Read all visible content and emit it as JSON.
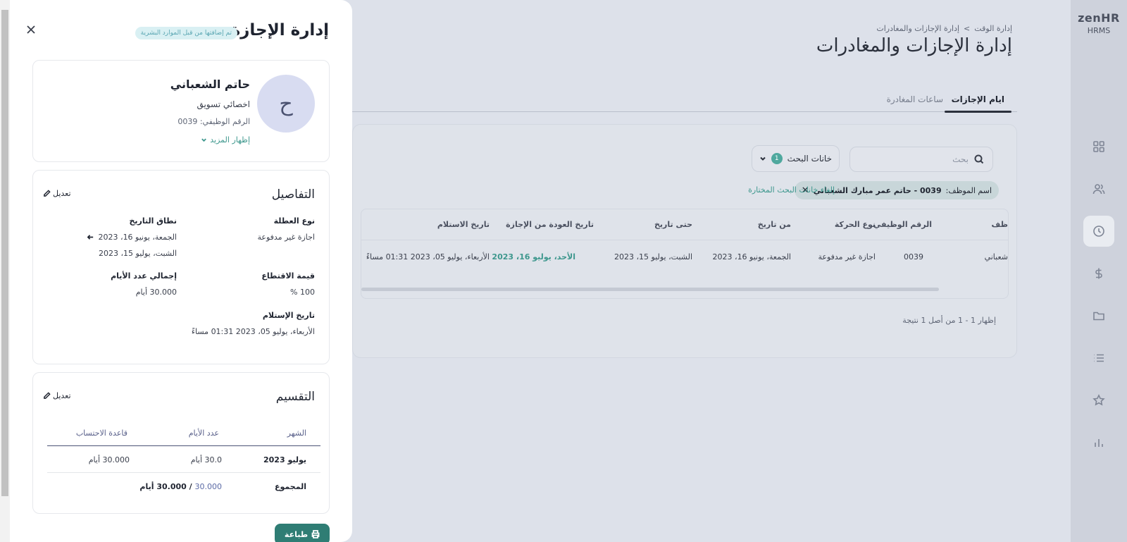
{
  "brand": {
    "name": "zenHR",
    "sub": "HRMS"
  },
  "page": {
    "breadcrumb": [
      "إدارة الوقت",
      "إدارة الإجازات والمغادرات"
    ],
    "breadcrumb_sep": ">",
    "title": "إدارة الإجازات والمغادرات",
    "tabs": [
      {
        "label": "ايام الإجازات",
        "active": true
      },
      {
        "label": "ساعات المغادرة",
        "active": false
      }
    ]
  },
  "toolbar": {
    "search_placeholder": "بحث",
    "filter_label": "خانات البحث",
    "filter_count": "1",
    "chip_label": "اسم الموظف:",
    "chip_value": "0039 - حاتم عمر مبارك الشعباني",
    "clear_label": "إلغاء خانات البحث المختارة"
  },
  "table": {
    "headers": [
      "ظف",
      "الرقم الوظيفي",
      "نوع الحركة",
      "من تاريخ",
      "حتى تاريخ",
      "تاريخ العودة من الإجازة",
      "تاريخ الاستلام"
    ],
    "row": [
      "شعباني",
      "0039",
      "اجازة غير مدفوعة",
      "الجمعة، يونيو 16، 2023",
      "الشبت، يوليو 15، 2023",
      "الأحد، يوليو 16، 2023",
      "الأربعاء، يوليو 05، 2023 01:31 مساءً"
    ],
    "results": "إظهار 1 - 1 من أصل 1 نتيجة"
  },
  "panel": {
    "title": "إدارة الإجازة",
    "hr_badge": "تم إضافتها من قبل الموارد البشرية",
    "employee": {
      "initial": "ح",
      "name": "حاتم الشعباني",
      "role": "اخصائي تسويق",
      "id_label": "الرقم الوظيفي: 0039",
      "more_label": "إظهار المزيد"
    },
    "details": {
      "title": "التفاصيل",
      "edit_label": "تعديل",
      "leave_type_label": "نوع العطلة",
      "leave_type_value": "اجازة غير مدفوعة",
      "range_label": "نطاق التاريخ",
      "range_from": "الجمعة، يونيو 16، 2023",
      "range_to": "الشبت، يوليو 15، 2023",
      "deduction_label": "قيمة الاقتطاع",
      "deduction_value": "100 %",
      "total_days_label": "إجمالي عدد الأيام",
      "total_days_value": "30.000 أيام",
      "received_label": "تاريخ الإستلام",
      "received_value": "الأربعاء، يوليو 05، 2023 01:31 مساءً"
    },
    "split": {
      "title": "التقسيم",
      "edit_label": "تعديل",
      "headers": [
        "الشهر",
        "عدد الأيام",
        "قاعدة الاحتساب"
      ],
      "row": [
        "يوليو 2023",
        "30.0 أيام",
        "30.000 أيام"
      ],
      "total_label": "المجموع",
      "total_accent": "30.000",
      "total_rest": " / 30.000 أيام"
    },
    "print_label": "طباعة"
  }
}
